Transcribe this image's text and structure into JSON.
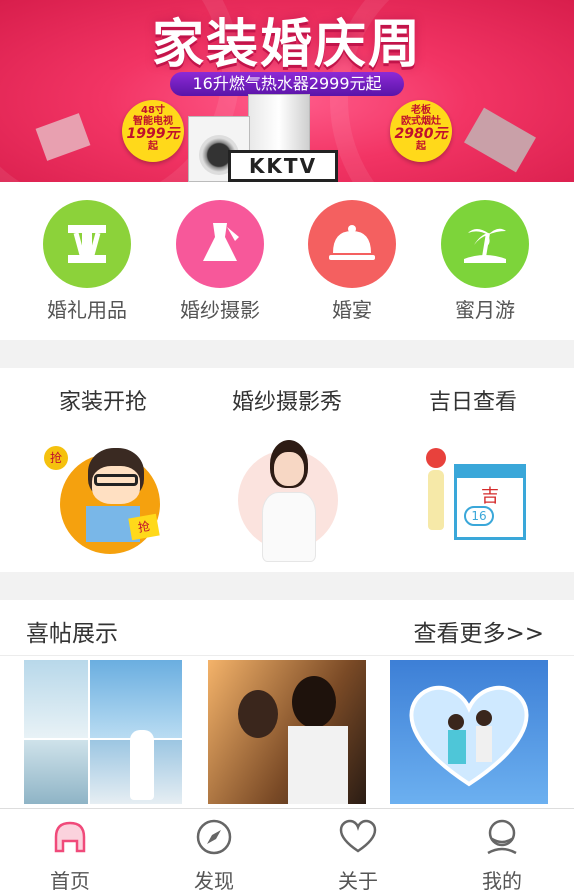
{
  "banner": {
    "title": "家装婚庆周",
    "subtitle": "16升燃气热水器2999元起",
    "tv_brand": "KKTV",
    "badge_left": {
      "line1": "48寸",
      "line2": "智能电视",
      "price": "1999元",
      "suffix": "起"
    },
    "badge_right": {
      "line1": "老板",
      "line2": "欧式烟灶",
      "price": "2980元",
      "suffix": "起"
    }
  },
  "categories": [
    {
      "label": "婚礼用品",
      "icon": "wedding-supplies-icon",
      "color": "#8cd23a"
    },
    {
      "label": "婚纱摄影",
      "icon": "dress-icon",
      "color": "#f7589a"
    },
    {
      "label": "婚宴",
      "icon": "cloche-icon",
      "color": "#f46060"
    },
    {
      "label": "蜜月游",
      "icon": "palm-island-icon",
      "color": "#7dd43a"
    }
  ],
  "features": [
    {
      "title": "家装开抢",
      "badge1": "抢",
      "badge2": "抢"
    },
    {
      "title": "婚纱摄影秀"
    },
    {
      "title": "吉日查看",
      "calendar_char": "吉",
      "calendar_num": "16"
    }
  ],
  "invites": {
    "title": "喜帖展示",
    "more": "查看更多>>"
  },
  "tabbar": [
    {
      "label": "首页",
      "icon": "home-icon",
      "active": true
    },
    {
      "label": "发现",
      "icon": "compass-icon",
      "active": false
    },
    {
      "label": "关于",
      "icon": "heart-icon",
      "active": false
    },
    {
      "label": "我的",
      "icon": "user-icon",
      "active": false
    }
  ],
  "colors": {
    "accent": "#f23464",
    "active_tab": "#f04a7a"
  }
}
